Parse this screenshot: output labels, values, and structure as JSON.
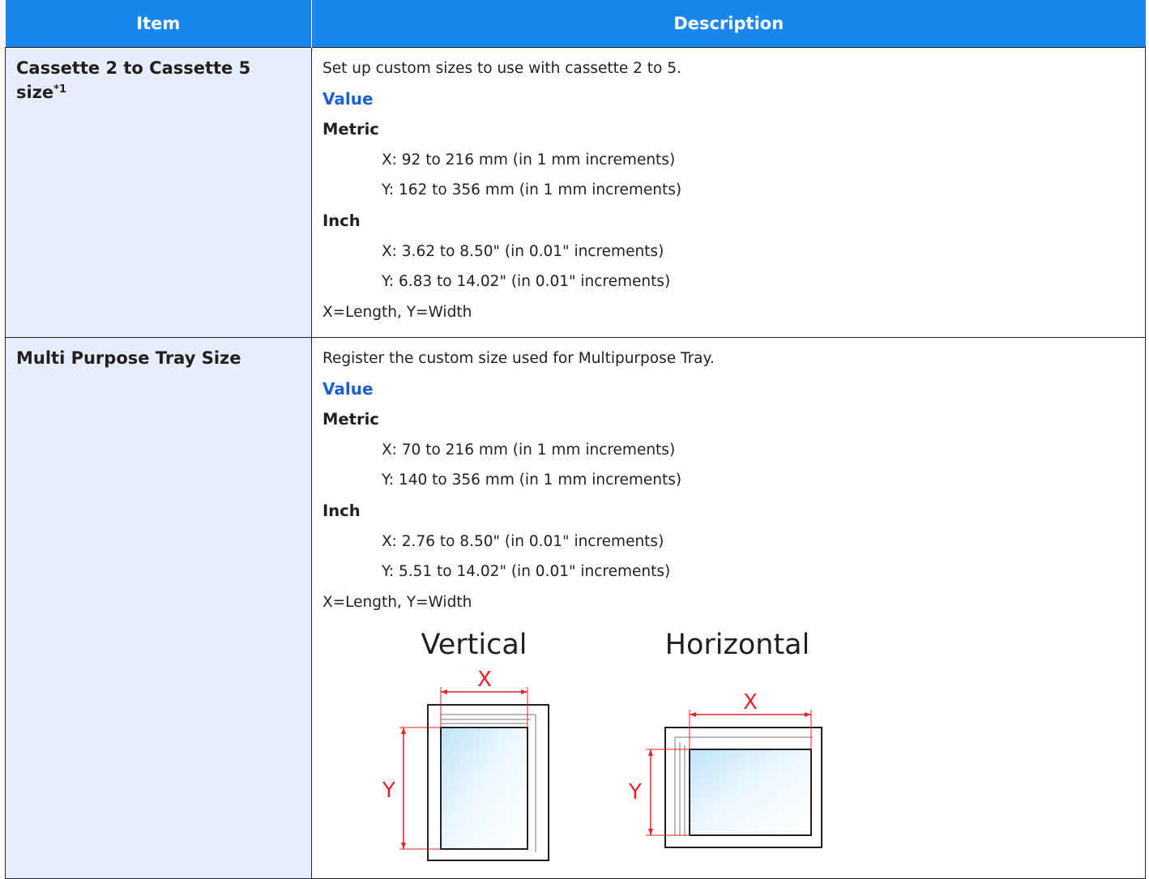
{
  "table": {
    "headers": [
      "Item",
      "Description"
    ],
    "rows": [
      {
        "item": "Cassette 2 to Cassette 5 size",
        "item_footnote": "*1",
        "lines": [
          {
            "text": "Set up custom sizes to use with cassette 2 to 5.",
            "style": "plain"
          },
          {
            "text": "Value",
            "style": "blue"
          },
          {
            "text": "Metric",
            "style": "bold"
          },
          {
            "text": "X: 92 to 216 mm (in 1 mm increments)",
            "style": "indent"
          },
          {
            "text": "Y: 162 to 356 mm (in 1 mm increments)",
            "style": "indent"
          },
          {
            "text": "Inch",
            "style": "bold"
          },
          {
            "text": "X: 3.62 to 8.50\" (in 0.01\" increments)",
            "style": "indent"
          },
          {
            "text": "Y: 6.83 to 14.02\" (in 0.01\" increments)",
            "style": "indent"
          },
          {
            "text": "X=Length, Y=Width",
            "style": "plain"
          }
        ]
      },
      {
        "item": "Multi Purpose Tray Size",
        "item_footnote": "",
        "lines": [
          {
            "text": "Register the custom size used for Multipurpose Tray.",
            "style": "plain"
          },
          {
            "text": "Value",
            "style": "blue"
          },
          {
            "text": "Metric",
            "style": "bold"
          },
          {
            "text": "X: 70 to 216 mm (in 1 mm increments)",
            "style": "indent"
          },
          {
            "text": "Y: 140 to 356 mm (in 1 mm increments)",
            "style": "indent"
          },
          {
            "text": "Inch",
            "style": "bold"
          },
          {
            "text": "X: 2.76 to 8.50\" (in 0.01\" increments)",
            "style": "indent"
          },
          {
            "text": "Y: 5.51 to 14.02\" (in 0.01\" increments)",
            "style": "indent"
          },
          {
            "text": "X=Length, Y=Width",
            "style": "plain"
          }
        ],
        "diagram": {
          "vertical_label": "Vertical",
          "horizontal_label": "Horizontal",
          "x_label": "X",
          "y_label": "Y",
          "dimension_color": "#e8202a"
        }
      }
    ]
  },
  "colors": {
    "header_bg": "#1a86ee",
    "item_bg": "#e6eefb",
    "value_blue": "#1a5fd6",
    "border": "#231f20"
  }
}
